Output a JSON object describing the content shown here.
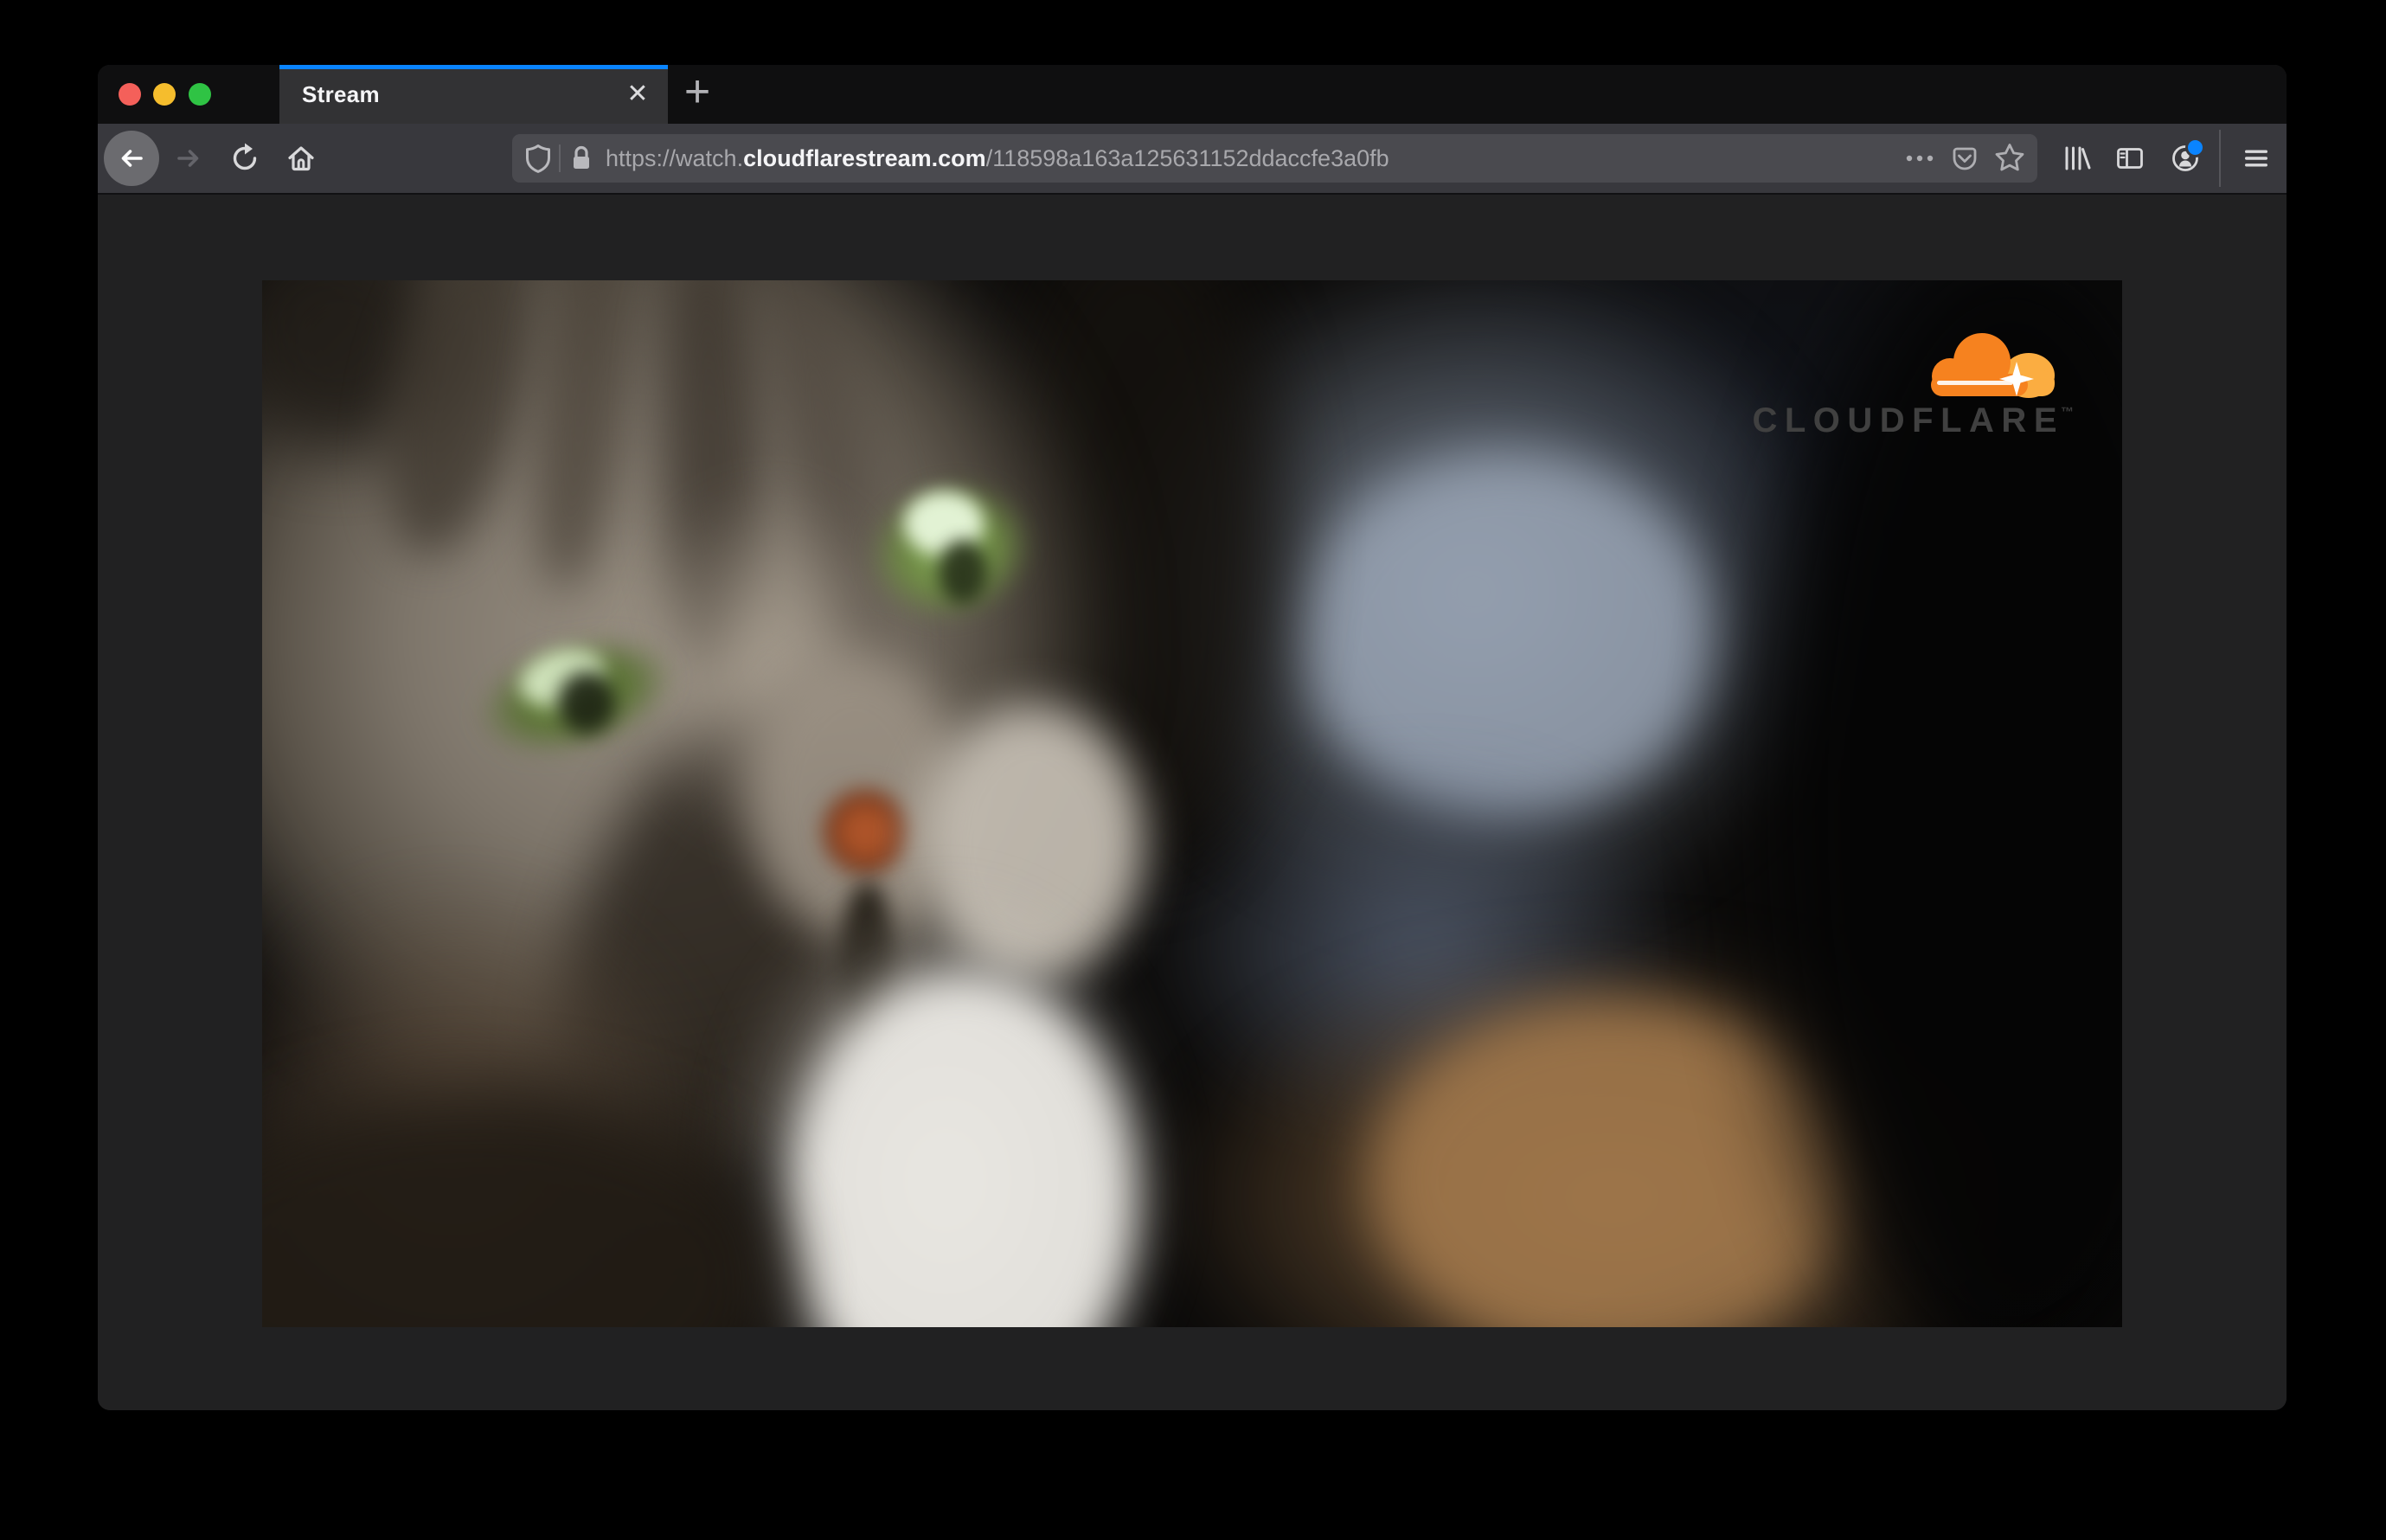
{
  "browser": {
    "window_controls": {
      "close": "close",
      "minimize": "minimize",
      "zoom": "zoom"
    },
    "tab": {
      "title": "Stream"
    },
    "url": {
      "prefix": "https://watch.",
      "domain": "cloudflarestream.com",
      "path": "/118598a163a125631152ddaccfe3a0fb"
    }
  },
  "icons": {
    "new_tab": "+",
    "tab_close": "✕",
    "back": "←",
    "forward": "→",
    "reload": "⟳",
    "home": "⌂",
    "shield": "tracking-protection-shield",
    "lock": "padlock",
    "page_actions": "•••",
    "pocket": "save-to-pocket",
    "bookmark": "☆",
    "library": "library-books",
    "sidebar": "sidebar-panel",
    "account": "account-person",
    "menu": "☰"
  },
  "video": {
    "brand_wordmark": "CLOUDFLARE",
    "brand_trademark": "™"
  },
  "colors": {
    "tab_accent_blue": "#0a84ff",
    "notification_blue": "#0a84ff",
    "traffic_red": "#f4605a",
    "traffic_yellow": "#f5bd2d",
    "traffic_green": "#2fc344",
    "cloudflare_orange": "#f6821f",
    "cloudflare_light_orange": "#fbad41",
    "toolbar_bg": "#38383d",
    "urlbar_bg": "#4a4a4f",
    "page_bg": "#212122"
  }
}
